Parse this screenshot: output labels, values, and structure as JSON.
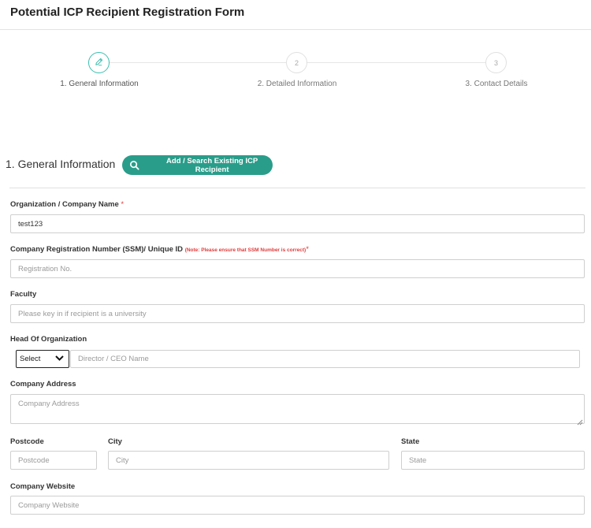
{
  "page": {
    "title": "Potential ICP Recipient Registration Form"
  },
  "stepper": {
    "steps": [
      {
        "number": "",
        "label": "1. General Information",
        "icon": "pencil-icon",
        "active": true
      },
      {
        "number": "2",
        "label": "2. Detailed Information",
        "active": false
      },
      {
        "number": "3",
        "label": "3. Contact Details",
        "active": false
      }
    ],
    "accent_color": "#3bbfb0"
  },
  "section": {
    "title": "1. General Information",
    "search_button_label": "Add / Search Existing ICP Recipient",
    "search_button_color": "#2a9d8a"
  },
  "form": {
    "org_name": {
      "label": "Organization / Company Name",
      "required": "*",
      "value": "test123"
    },
    "registration": {
      "label": "Company Registration Number (SSM)/ Unique ID",
      "note": "(Note: Please ensure that SSM Number is correct)",
      "required": "*",
      "placeholder": "Registration No.",
      "value": ""
    },
    "faculty": {
      "label": "Faculty",
      "placeholder": "Please key in if recipient is a university",
      "value": ""
    },
    "head": {
      "label": "Head Of Organization",
      "select_value": "Select",
      "placeholder": "Director / CEO Name",
      "value": ""
    },
    "address": {
      "label": "Company Address",
      "placeholder": "Company Address",
      "value": ""
    },
    "postcode": {
      "label": "Postcode",
      "placeholder": "Postcode",
      "value": ""
    },
    "city": {
      "label": "City",
      "placeholder": "City",
      "value": ""
    },
    "state": {
      "label": "State",
      "placeholder": "State",
      "value": ""
    },
    "website": {
      "label": "Company Website",
      "placeholder": "Company Website",
      "value": ""
    }
  }
}
